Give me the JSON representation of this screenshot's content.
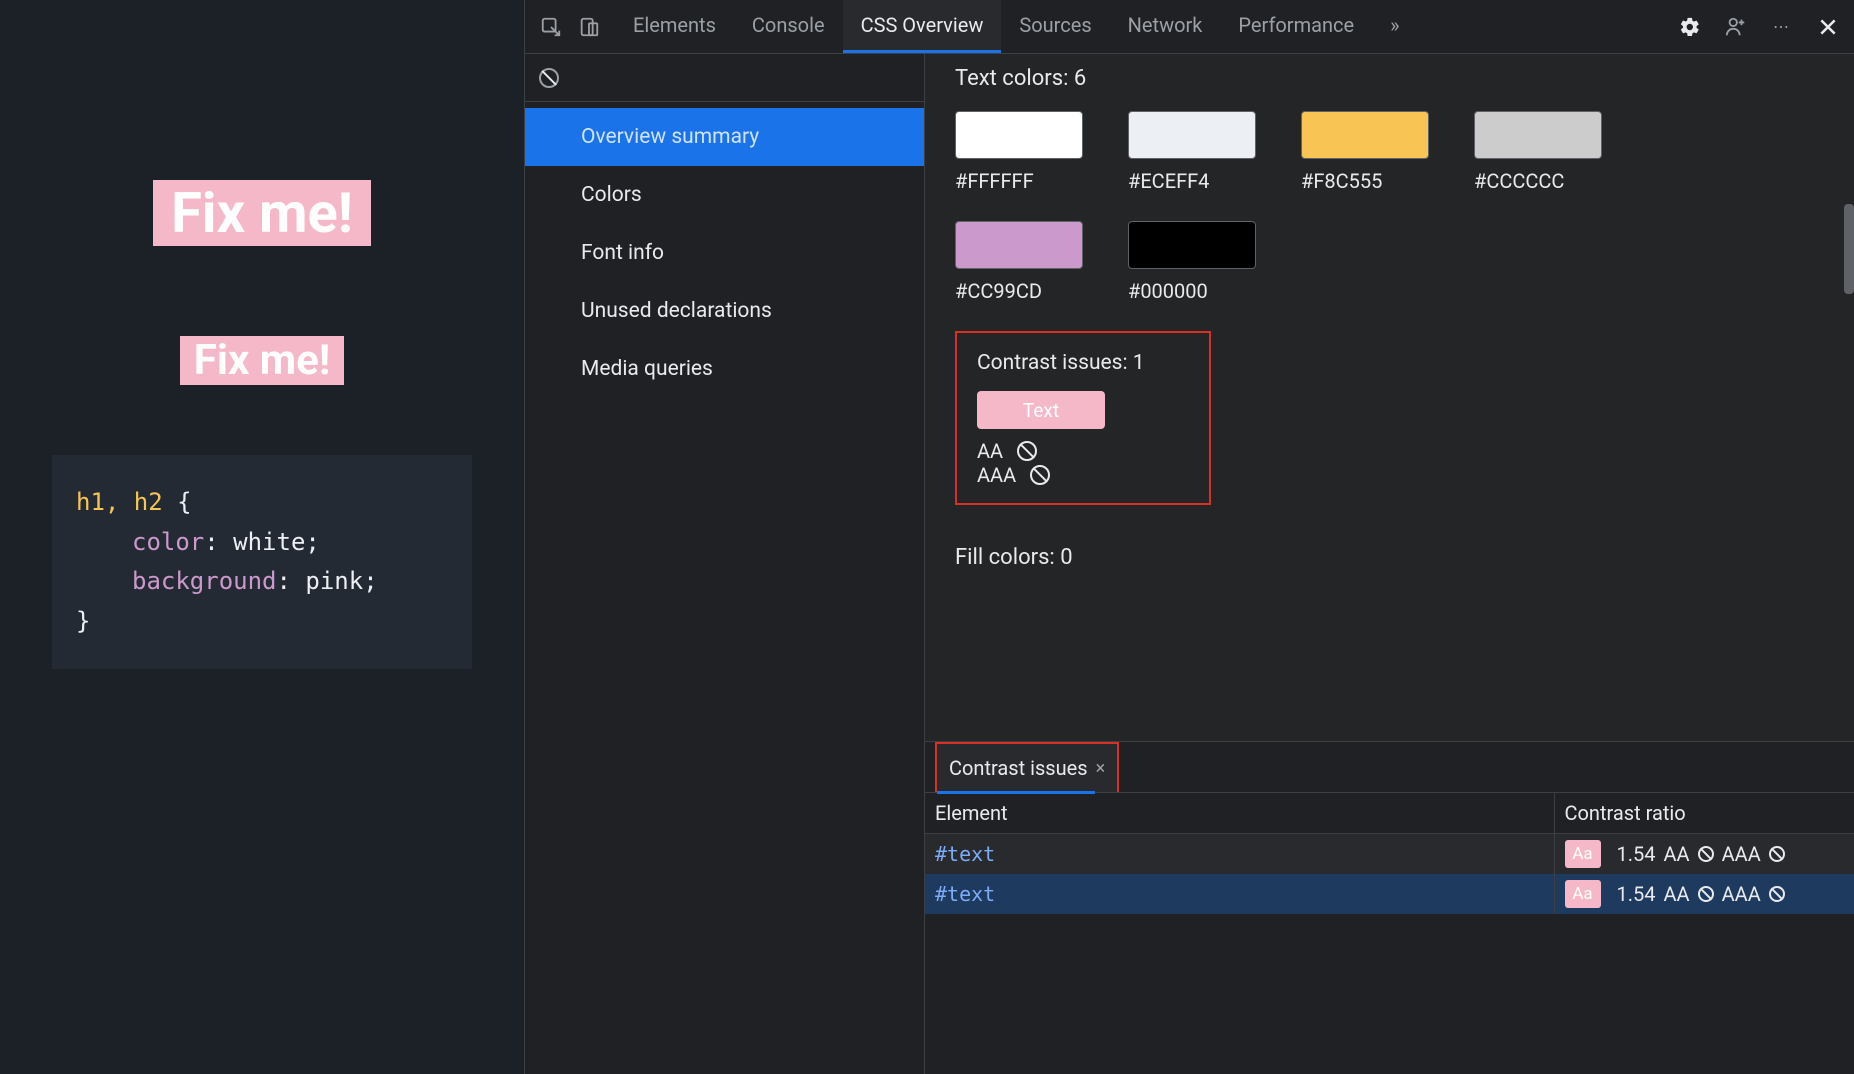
{
  "page": {
    "h1": "Fix me!",
    "h2": "Fix me!",
    "code": {
      "selector": "h1, h2",
      "brace_open": " {",
      "prop1": "color",
      "val1": "white",
      "prop2": "background",
      "val2": "pink",
      "brace_close": "}",
      "colon": ": ",
      "semi": ";"
    }
  },
  "toolbar": {
    "tabs": {
      "elements": "Elements",
      "console": "Console",
      "css_overview": "CSS Overview",
      "sources": "Sources",
      "network": "Network",
      "performance": "Performance"
    },
    "more": "»"
  },
  "sidebar": {
    "items": {
      "overview": "Overview summary",
      "colors": "Colors",
      "font_info": "Font info",
      "unused": "Unused declarations",
      "media": "Media queries"
    }
  },
  "content": {
    "text_colors_title": "Text colors: 6",
    "swatches": [
      {
        "hex": "#FFFFFF"
      },
      {
        "hex": "#ECEFF4"
      },
      {
        "hex": "#F8C555"
      },
      {
        "hex": "#CCCCCC"
      },
      {
        "hex": "#CC99CD"
      },
      {
        "hex": "#000000"
      }
    ],
    "contrast_box": {
      "title": "Contrast issues: 1",
      "swatch_label": "Text",
      "aa": "AA",
      "aaa": "AAA"
    },
    "fill_title": "Fill colors: 0"
  },
  "bottom": {
    "tab_label": "Contrast issues",
    "close": "×",
    "headers": {
      "element": "Element",
      "ratio": "Contrast ratio"
    },
    "rows": [
      {
        "element": "#text",
        "swatch": "Aa",
        "ratio": "1.54",
        "aa": "AA",
        "aaa": "AAA"
      },
      {
        "element": "#text",
        "swatch": "Aa",
        "ratio": "1.54",
        "aa": "AA",
        "aaa": "AAA"
      }
    ]
  }
}
